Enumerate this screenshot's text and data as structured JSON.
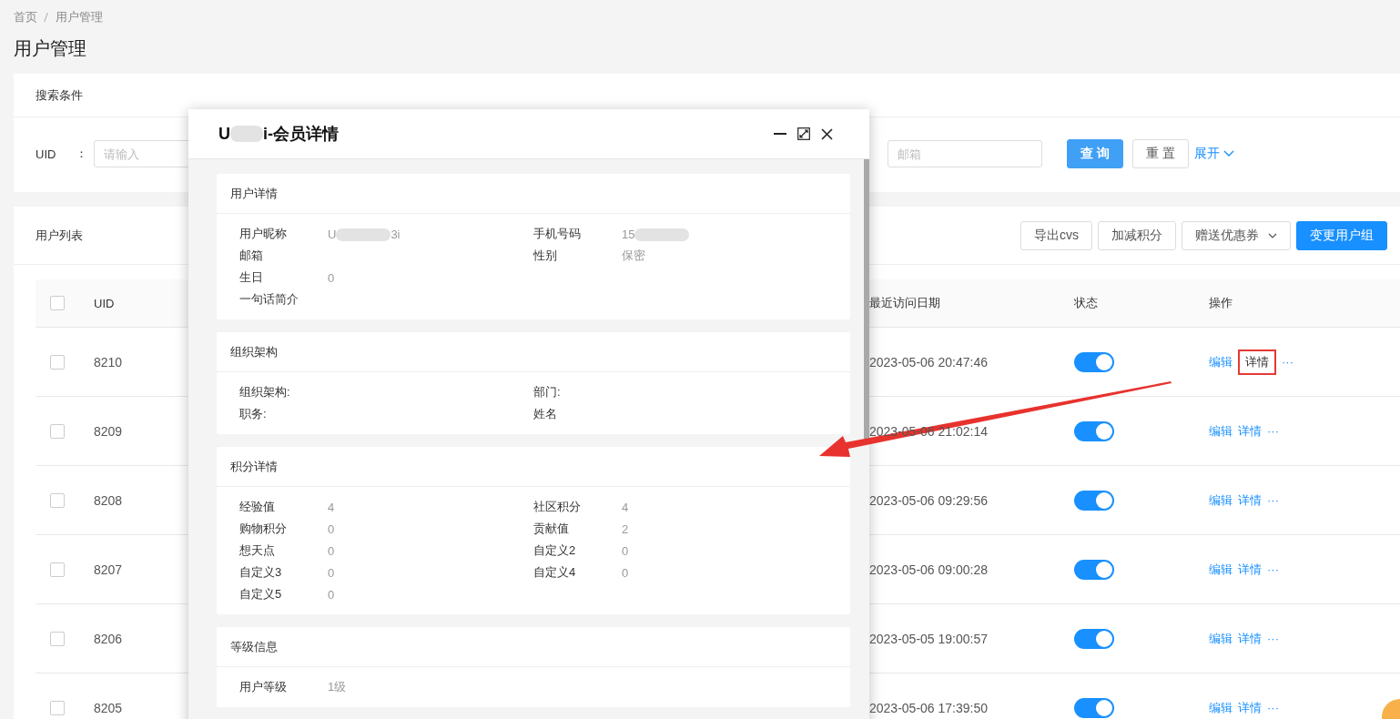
{
  "breadcrumb": [
    "首页",
    "用户管理"
  ],
  "page_title": "用户管理",
  "search": {
    "title": "搜索条件",
    "uid_label": "UID",
    "colon": "：",
    "uid_placeholder": "请输入",
    "email_placeholder": "邮箱",
    "query": "查 询",
    "reset": "重 置",
    "expand": "展开"
  },
  "list": {
    "title": "用户列表",
    "buttons": [
      {
        "label": "导出cvs",
        "kind": "plain"
      },
      {
        "label": "加减积分",
        "kind": "plain"
      },
      {
        "label": "赠送优惠券",
        "kind": "dropdown"
      },
      {
        "label": "变更用户组",
        "kind": "primary"
      }
    ]
  },
  "table": {
    "columns": [
      "UID",
      "最近访问日期",
      "状态",
      "操作"
    ],
    "all_checked": false,
    "rows": [
      {
        "checked": false,
        "uid": "8210",
        "date": "2023-05-06 20:47:46",
        "on": true,
        "edit": "编辑",
        "detail": "详情",
        "more": "···",
        "highlighted": true
      },
      {
        "checked": false,
        "uid": "8209",
        "date": "2023-05-06 21:02:14",
        "on": true,
        "edit": "编辑",
        "detail": "详情",
        "more": "···",
        "highlighted": false
      },
      {
        "checked": false,
        "uid": "8208",
        "date": "2023-05-06 09:29:56",
        "on": true,
        "edit": "编辑",
        "detail": "详情",
        "more": "···",
        "highlighted": false
      },
      {
        "checked": false,
        "uid": "8207",
        "date": "2023-05-06 09:00:28",
        "on": true,
        "edit": "编辑",
        "detail": "详情",
        "more": "···",
        "highlighted": false
      },
      {
        "checked": false,
        "uid": "8206",
        "date": "2023-05-05 19:00:57",
        "on": true,
        "edit": "编辑",
        "detail": "详情",
        "more": "···",
        "highlighted": false
      },
      {
        "checked": false,
        "uid": "8205",
        "date": "2023-05-06 17:39:50",
        "on": true,
        "edit": "编辑",
        "detail": "详情",
        "more": "···",
        "highlighted": false
      }
    ]
  },
  "modal": {
    "title": "U",
    "title_redacted": true,
    "title_end": "i-会员详情",
    "sections": [
      {
        "title": "用户详情",
        "rows": [
          {
            "left": {
              "label": "用户昵称",
              "value": "U",
              "redacted": true,
              "value_end": "3i"
            },
            "right": {
              "label": "手机号码",
              "value": "15",
              "redacted": true
            }
          },
          {
            "left": {
              "label": "邮箱"
            },
            "right": {
              "label": "性别",
              "value": "保密"
            }
          },
          {
            "left": {
              "label": "生日",
              "value": "0"
            }
          },
          {
            "left": {
              "label": "一句话简介"
            }
          }
        ]
      },
      {
        "title": "组织架构",
        "rows": [
          {
            "left": {
              "label": "组织架构:"
            },
            "right": {
              "label": "部门:"
            }
          },
          {
            "left": {
              "label": "职务:"
            },
            "right": {
              "label": "姓名"
            }
          }
        ]
      },
      {
        "title": "积分详情",
        "rows": [
          {
            "left": {
              "label": "经验值",
              "value": "4"
            },
            "right": {
              "label": "社区积分",
              "value": "4"
            }
          },
          {
            "left": {
              "label": "购物积分",
              "value": "0"
            },
            "right": {
              "label": "贡献值",
              "value": "2"
            }
          },
          {
            "left": {
              "label": "想天点",
              "value": "0"
            },
            "right": {
              "label": "自定义2",
              "value": "0"
            }
          },
          {
            "left": {
              "label": "自定义3",
              "value": "0"
            },
            "right": {
              "label": "自定义4",
              "value": "0"
            }
          },
          {
            "left": {
              "label": "自定义5",
              "value": "0"
            }
          }
        ]
      },
      {
        "title": "等级信息",
        "rows": [
          {
            "left": {
              "label": "用户等级",
              "value": "1级"
            }
          }
        ]
      }
    ]
  }
}
